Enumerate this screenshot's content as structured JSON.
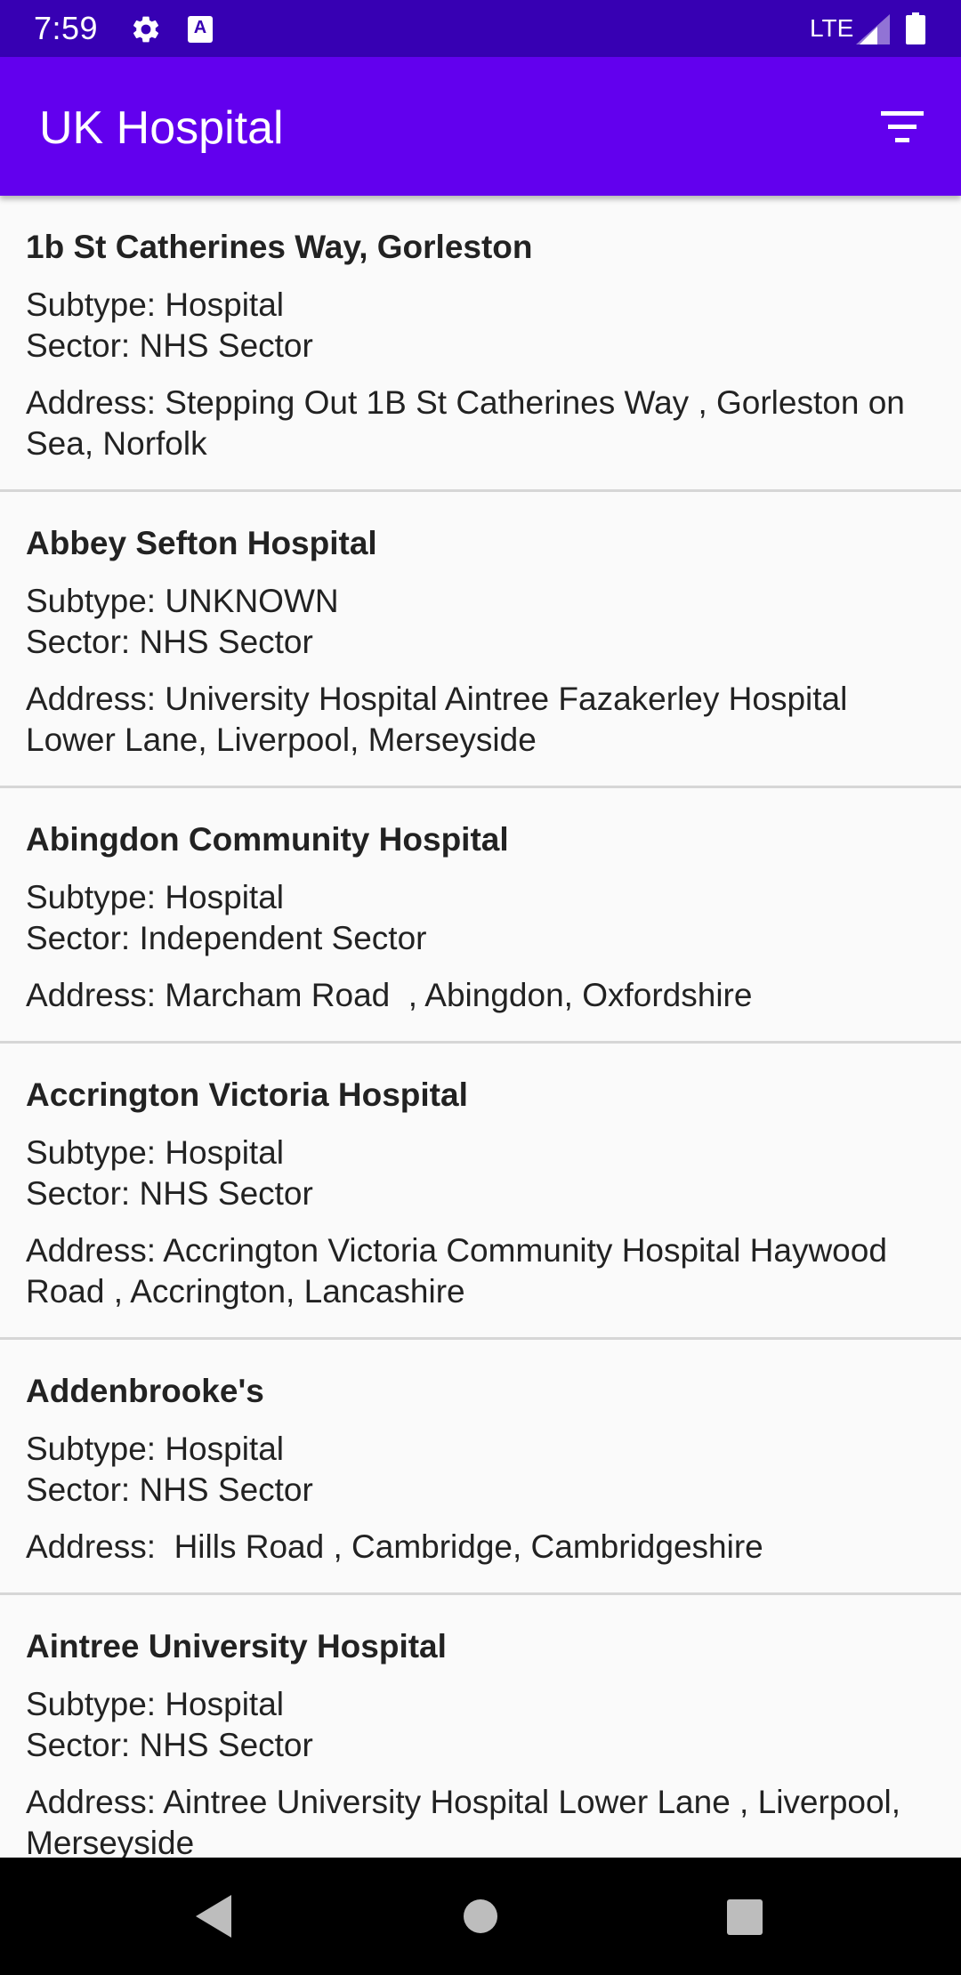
{
  "status_bar": {
    "time": "7:59",
    "network": "LTE",
    "a_icon_letter": "A",
    "icons": [
      "gear-icon",
      "a-icon",
      "signal-icon",
      "battery-icon"
    ]
  },
  "app_bar": {
    "title": "UK Hospital",
    "filter_icon": "filter-icon"
  },
  "colors": {
    "status_bar": "#3700b3",
    "app_bar": "#6200ee",
    "background": "#fafafa",
    "divider": "#d6d6d6",
    "nav_bar": "#000000"
  },
  "hospitals": [
    {
      "name": "1b St Catherines Way, Gorleston",
      "subtype": "Subtype: Hospital",
      "sector": "Sector: NHS Sector",
      "address": "Address: Stepping Out 1B St Catherines Way , Gorleston on Sea, Norfolk"
    },
    {
      "name": "Abbey Sefton Hospital",
      "subtype": "Subtype: UNKNOWN",
      "sector": "Sector: NHS Sector",
      "address": "Address: University Hospital Aintree Fazakerley Hospital Lower Lane, Liverpool, Merseyside"
    },
    {
      "name": "Abingdon Community Hospital",
      "subtype": "Subtype: Hospital",
      "sector": "Sector: Independent Sector",
      "address": "Address: Marcham Road  , Abingdon, Oxfordshire"
    },
    {
      "name": "Accrington Victoria Hospital",
      "subtype": "Subtype: Hospital",
      "sector": "Sector: NHS Sector",
      "address": "Address: Accrington Victoria Community Hospital Haywood Road , Accrington, Lancashire"
    },
    {
      "name": "Addenbrooke's",
      "subtype": "Subtype: Hospital",
      "sector": "Sector: NHS Sector",
      "address": "Address:  Hills Road , Cambridge, Cambridgeshire"
    },
    {
      "name": "Aintree University Hospital",
      "subtype": "Subtype: Hospital",
      "sector": "Sector: NHS Sector",
      "address": "Address: Aintree University Hospital Lower Lane , Liverpool, Merseyside"
    }
  ],
  "nav_bar": {
    "icons": [
      "back-icon",
      "home-icon",
      "recents-icon"
    ]
  }
}
